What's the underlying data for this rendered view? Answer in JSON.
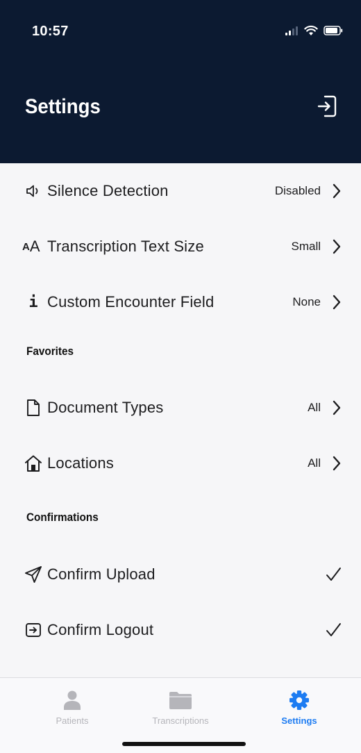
{
  "status_bar": {
    "time": "10:57"
  },
  "header": {
    "title": "Settings"
  },
  "settings_rows": [
    {
      "label": "Silence Detection",
      "value": "Disabled",
      "icon": "speaker-icon"
    },
    {
      "label": "Transcription Text Size",
      "value": "Small",
      "icon": "text-size-icon",
      "icon_text": "AA"
    },
    {
      "label": "Custom Encounter Field",
      "value": "None",
      "icon": "info-icon",
      "icon_text": "i"
    }
  ],
  "favorites": {
    "title": "Favorites",
    "rows": [
      {
        "label": "Document Types",
        "value": "All",
        "icon": "document-icon"
      },
      {
        "label": "Locations",
        "value": "All",
        "icon": "house-icon"
      }
    ]
  },
  "confirmations": {
    "title": "Confirmations",
    "rows": [
      {
        "label": "Confirm Upload",
        "checked": true,
        "icon": "paper-plane-icon"
      },
      {
        "label": "Confirm Logout",
        "checked": true,
        "icon": "logout-box-icon"
      }
    ]
  },
  "tabbar": {
    "tabs": [
      {
        "label": "Patients",
        "icon": "person-icon",
        "active": false
      },
      {
        "label": "Transcriptions",
        "icon": "folder-icon",
        "active": false
      },
      {
        "label": "Settings",
        "icon": "gear-icon",
        "active": true
      }
    ]
  },
  "colors": {
    "header_bg": "#0c1a31",
    "accent": "#1d7cf2",
    "inactive_tab": "#b5b5ba"
  }
}
